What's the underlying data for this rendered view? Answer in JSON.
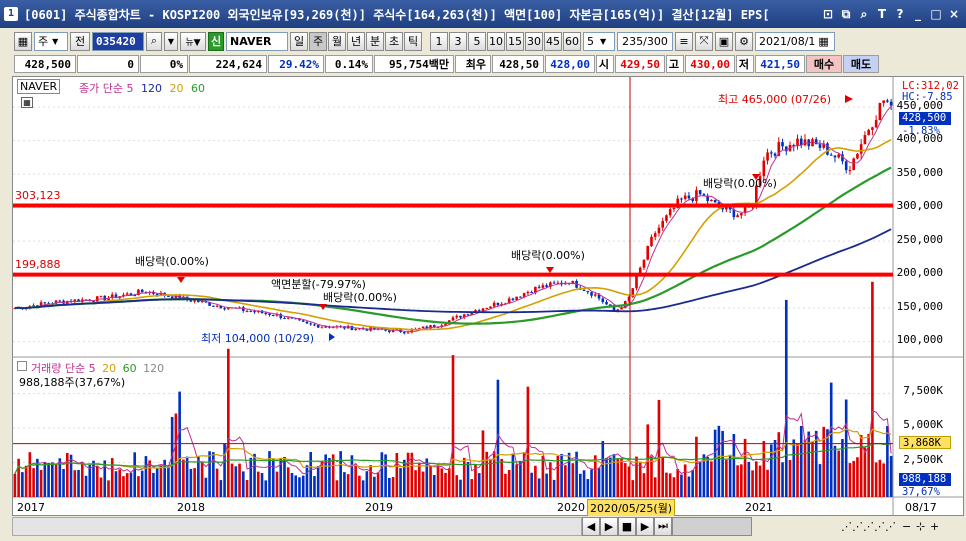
{
  "window": {
    "number": "1",
    "title": "[0601] 주식종합차트 - KOSPI200 외국인보유[93,269(천)] 주식수[164,263(천)] 액면[100] 자본금[165(억)] 결산[12월] EPS[",
    "controls": [
      "⊡",
      "⧉",
      "🔍",
      "T",
      "?",
      "_",
      "□",
      "×"
    ]
  },
  "toolbar": {
    "market_select": "주",
    "jeon_btn": "전",
    "stock_code": "035420",
    "new_label": "신",
    "stock_name": "NAVER",
    "period_btns": [
      "일",
      "주",
      "월",
      "년",
      "분",
      "초",
      "틱"
    ],
    "active_period": "주",
    "interval_btns": [
      "1",
      "3",
      "5",
      "10",
      "15",
      "30",
      "45",
      "60"
    ],
    "interval_value": "5",
    "count_value": "235",
    "count_total": "/300",
    "date_value": "2021/08/1"
  },
  "quote": {
    "price": "428,500",
    "change": "0",
    "change_pct": "0%",
    "volume": "224,624",
    "vol_ratio": "29.42%",
    "turnover": "0.14%",
    "amount": "95,754백만",
    "best_label": "최우",
    "best": "428,50",
    "last": "428,00",
    "open_label": "시",
    "open": "429,50",
    "high_label": "고",
    "high": "430,00",
    "low_label": "저",
    "low": "421,50",
    "buy": "매수",
    "sell": "매도"
  },
  "legend": {
    "stock_name": "NAVER",
    "ma_prefix": "종가 단순",
    "ma": [
      "5",
      "120",
      "20",
      "60"
    ]
  },
  "annotations": {
    "line_high": "303,123",
    "line_low": "199,888",
    "dividend_labels": [
      "배당락(0.00%)",
      "배당락(0.00%)",
      "배당락(0.00%)",
      "배당락(0.00%)"
    ],
    "split": "액면분할(-79.97%)",
    "max": "최고 465,000 (07/26)",
    "min": "최저 104,000 (10/29)"
  },
  "price_axis": [
    "450,000",
    "400,000",
    "350,000",
    "300,000",
    "250,000",
    "200,000",
    "150,000",
    "100,000"
  ],
  "price_tags": {
    "lc": "LC:312,02",
    "hc": "HC:-7.85",
    "price": "428,500",
    "pct": "-1.83%"
  },
  "volume": {
    "title": "거래량 단순",
    "ma": [
      "5",
      "20",
      "60",
      "120"
    ],
    "value": "988,188주(37,67%)",
    "axis": [
      "7,500K",
      "5,000K",
      "2,500K"
    ],
    "tag_ma": "3,868K",
    "tag_val": "988,188",
    "tag_pct": "37,67%"
  },
  "x_axis": [
    "2017",
    "2018",
    "2019",
    "2020",
    "2021",
    "08/17"
  ],
  "cursor_date": "2020/05/25(월)",
  "colors": {
    "up": "#e00000",
    "down": "#0030c0",
    "ma5": "#c03090",
    "ma20": "#d4a000",
    "ma60": "#2a9a2a",
    "ma120": "#1a2a90"
  },
  "chart_data": {
    "type": "candlestick",
    "series": [
      {
        "name": "NAVER",
        "values": []
      }
    ],
    "ylabel": "",
    "ylim": [
      80000,
      480000
    ]
  }
}
